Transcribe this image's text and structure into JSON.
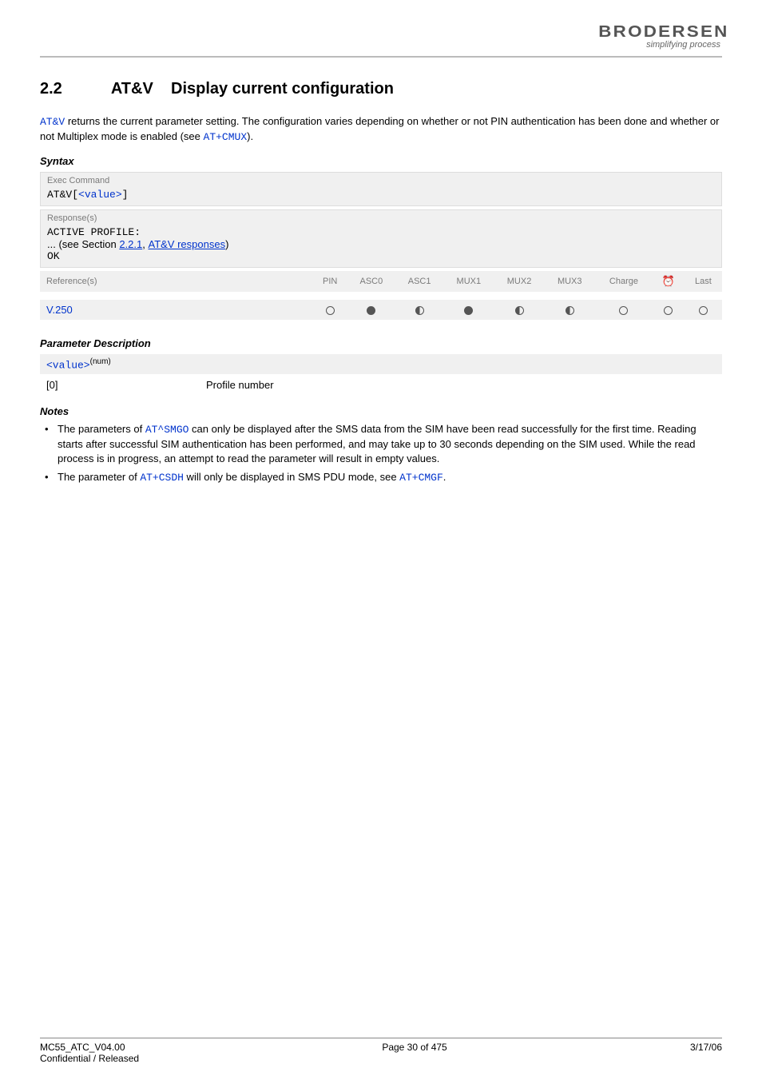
{
  "header": {
    "brand": "BRODERSEN",
    "tagline": "simplifying process"
  },
  "section": {
    "number": "2.2",
    "title_cmd": "AT&V",
    "title_rest": "Display current configuration"
  },
  "intro": {
    "cmd": "AT&V",
    "text_mid": " returns the current parameter setting. The configuration varies depending on whether or not PIN authentication has been done and whether or not Multiplex mode is enabled (see ",
    "cmd2": "AT+CMUX",
    "text_end": ")."
  },
  "syntax": {
    "heading": "Syntax",
    "exec_label": "Exec Command",
    "exec_cmd": "AT&V",
    "exec_param": "<value>",
    "response_label": "Response(s)",
    "resp_line1": "ACTIVE PROFILE:",
    "resp_prefix": "... (see Section ",
    "resp_link1": "2.2.1",
    "resp_sep": ", ",
    "resp_link2": "AT&V responses",
    "resp_suffix": ")",
    "resp_ok": "OK",
    "ref_label": "Reference(s)",
    "ref_value": "V.250",
    "columns": [
      "PIN",
      "ASC0",
      "ASC1",
      "MUX1",
      "MUX2",
      "MUX3",
      "Charge",
      "",
      "Last"
    ],
    "row_icons": [
      "empty",
      "full",
      "half",
      "full",
      "half",
      "half",
      "empty",
      "empty",
      "empty"
    ]
  },
  "param": {
    "heading": "Parameter Description",
    "name": "<value>",
    "sup": "(num)",
    "default": "[0]",
    "desc": "Profile number"
  },
  "notes": {
    "heading": "Notes",
    "n1a": "The parameters of ",
    "n1cmd": "AT^SMGO",
    "n1b": " can only be displayed after the SMS data from the SIM have been read successfully for the first time. Reading starts after successful SIM authentication has been performed, and may take up to 30 seconds depending on the SIM used. While the read process is in progress, an attempt to read the parameter will result in empty values.",
    "n2a": "The parameter of ",
    "n2cmd": "AT+CSDH",
    "n2b": " will only be displayed in SMS PDU mode, see ",
    "n2cmd2": "AT+CMGF",
    "n2c": "."
  },
  "footer": {
    "doc": "MC55_ATC_V04.00",
    "conf": "Confidential / Released",
    "page": "Page 30 of 475",
    "date": "3/17/06"
  }
}
